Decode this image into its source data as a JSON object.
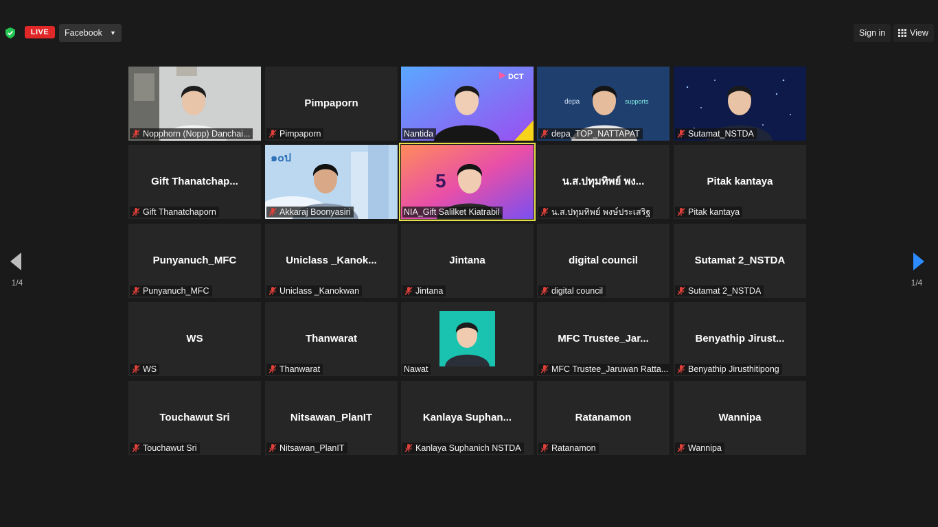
{
  "toolbar": {
    "live_label": "LIVE",
    "stream_target": "Facebook",
    "sign_in_label": "Sign in",
    "view_label": "View"
  },
  "pagination": {
    "left_page": "1/4",
    "right_page": "1/4"
  },
  "colors": {
    "accent_blue": "#2d8cff",
    "live_red": "#e02828",
    "muted_red": "#e0403a",
    "active_speaker": "#e8e04a"
  },
  "participants": [
    {
      "label": "Nopphorn (Nopp) Danchai...",
      "tile_name": "",
      "video": "video-office",
      "muted": true
    },
    {
      "label": "Pimpaporn",
      "tile_name": "Pimpaporn",
      "video": "",
      "muted": true
    },
    {
      "label": "Nantida",
      "tile_name": "",
      "video": "video-dct",
      "muted": false
    },
    {
      "label": "depa_TOP_NATTAPAT",
      "tile_name": "",
      "video": "video-depa",
      "muted": true
    },
    {
      "label": "Sutamat_NSTDA",
      "tile_name": "",
      "video": "video-stars",
      "muted": true
    },
    {
      "label": "Gift Thanatchaporn",
      "tile_name": "Gift  Thanatchap...",
      "video": "",
      "muted": true
    },
    {
      "label": "Akkaraj Boonyasiri",
      "tile_name": "",
      "video": "video-sky",
      "muted": true
    },
    {
      "label": "NIA_Gift Salilket Kiatrabil",
      "tile_name": "",
      "video": "video-nia",
      "muted": false,
      "active": true
    },
    {
      "label": "น.ส.ปทุมทิพย์ พงษ์ประเสริฐ",
      "tile_name": "น.ส.ปทุมทิพย์  พง...",
      "video": "",
      "muted": true
    },
    {
      "label": "Pitak kantaya",
      "tile_name": "Pitak kantaya",
      "video": "",
      "muted": true
    },
    {
      "label": "Punyanuch_MFC",
      "tile_name": "Punyanuch_MFC",
      "video": "",
      "muted": true
    },
    {
      "label": "Uniclass _Kanokwan",
      "tile_name": "Uniclass  _Kanok...",
      "video": "",
      "muted": true
    },
    {
      "label": "Jintana",
      "tile_name": "Jintana",
      "video": "",
      "muted": true
    },
    {
      "label": "digital council",
      "tile_name": "digital council",
      "video": "",
      "muted": true
    },
    {
      "label": "Sutamat 2_NSTDA",
      "tile_name": "Sutamat 2_NSTDA",
      "video": "",
      "muted": true
    },
    {
      "label": "WS",
      "tile_name": "WS",
      "video": "",
      "muted": true
    },
    {
      "label": "Thanwarat",
      "tile_name": "Thanwarat",
      "video": "",
      "muted": true
    },
    {
      "label": "Nawat",
      "tile_name": "",
      "video": "avatar-nawat",
      "muted": false
    },
    {
      "label": "MFC Trustee_Jaruwan Ratta...",
      "tile_name": "MFC  Trustee_Jar...",
      "video": "",
      "muted": true
    },
    {
      "label": "Benyathip Jirusthitipong",
      "tile_name": "Benyathip  Jirust...",
      "video": "",
      "muted": true
    },
    {
      "label": "Touchawut Sri",
      "tile_name": "Touchawut Sri",
      "video": "",
      "muted": true
    },
    {
      "label": "Nitsawan_PlanIT",
      "tile_name": "Nitsawan_PlanIT",
      "video": "",
      "muted": true
    },
    {
      "label": "Kanlaya Suphanich NSTDA",
      "tile_name": "Kanlaya  Suphan...",
      "video": "",
      "muted": true
    },
    {
      "label": "Ratanamon",
      "tile_name": "Ratanamon",
      "video": "",
      "muted": true
    },
    {
      "label": "Wannipa",
      "tile_name": "Wannipa",
      "video": "",
      "muted": true
    }
  ]
}
